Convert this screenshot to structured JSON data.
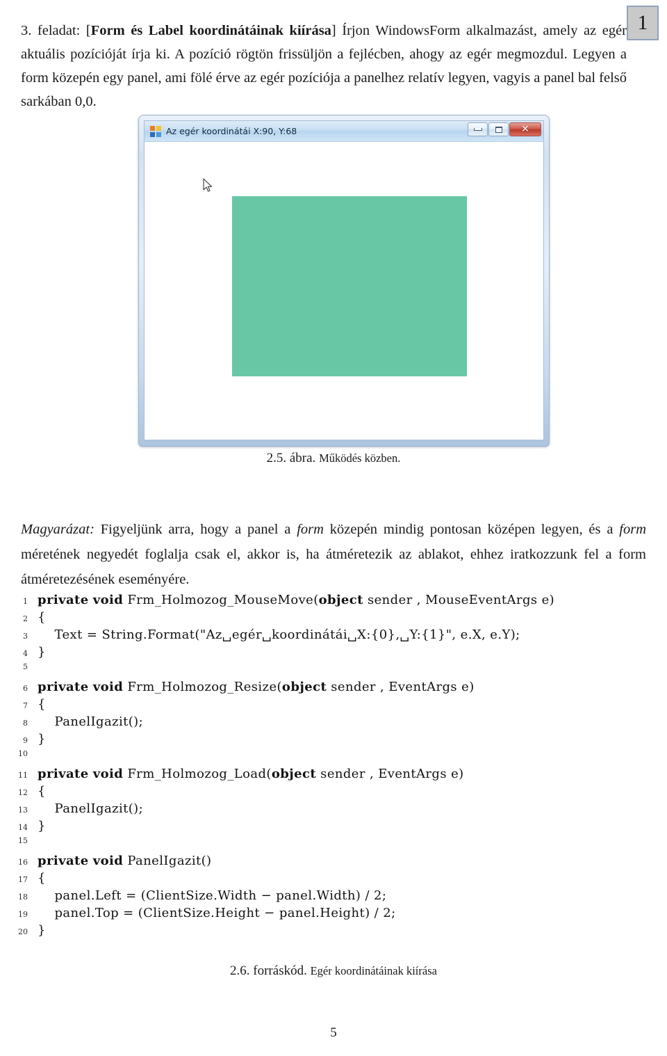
{
  "margin_marker": {
    "label": "1"
  },
  "intro": {
    "number": "3. feladat:",
    "bracket_open": "[",
    "bold_title": "Form és Label koordinátáinak kiírása",
    "bracket_close": "]",
    "body": "Írjon WindowsForm alkalmazást, amely az egér aktuális pozícióját írja ki. A pozíció rögtön frissüljön a fejlécben, ahogy az egér megmozdul. Legyen a form közepén egy panel, ami fölé érve az egér pozíciója a panelhez relatív legyen, vagyis a panel bal felső sarkában 0,0."
  },
  "screenshot": {
    "window_title": "Az egér koordinátái X:90, Y:68",
    "app_icon": "winforms-app-icon",
    "buttons": {
      "minimize": "minimize-icon",
      "maximize": "maximize-icon",
      "close": "✕"
    },
    "cursor": "arrow-cursor",
    "panel_color": "#68c8a6"
  },
  "figure_caption": {
    "label": "2.5. ábra.",
    "text": "Működés közben."
  },
  "explanation": {
    "lead": "Magyarázat:",
    "part1": " Figyeljünk arra, hogy a panel a ",
    "em1": "form",
    "part2": " közepén mindig pontosan középen legyen, és a ",
    "em2": "form",
    "part3": " méretének negyedét foglalja csak el, akkor is, ha átméretezik az ablakot, ehhez iratkozzunk fel a form átméretezésének eseményére."
  },
  "code": {
    "lines": [
      {
        "n": "1",
        "text": "private void Frm_Holmozog_MouseMove(object sender , MouseEventArgs e)"
      },
      {
        "n": "2",
        "text": "{"
      },
      {
        "n": "3",
        "text": "    Text = String.Format(\"Az␣egér␣koordinátái␣X:{0},␣Y:{1}\", e.X, e.Y);"
      },
      {
        "n": "4",
        "text": "}"
      },
      {
        "n": "5",
        "text": ""
      },
      {
        "n": "6",
        "text": "private void Frm_Holmozog_Resize(object sender , EventArgs e)"
      },
      {
        "n": "7",
        "text": "{"
      },
      {
        "n": "8",
        "text": "    PanelIgazit();"
      },
      {
        "n": "9",
        "text": "}"
      },
      {
        "n": "10",
        "text": ""
      },
      {
        "n": "11",
        "text": "private void Frm_Holmozog_Load(object sender , EventArgs e)"
      },
      {
        "n": "12",
        "text": "{"
      },
      {
        "n": "13",
        "text": "    PanelIgazit();"
      },
      {
        "n": "14",
        "text": "}"
      },
      {
        "n": "15",
        "text": ""
      },
      {
        "n": "16",
        "text": "private void PanelIgazit()"
      },
      {
        "n": "17",
        "text": "{"
      },
      {
        "n": "18",
        "text": "    panel.Left = (ClientSize.Width − panel.Width) / 2;"
      },
      {
        "n": "19",
        "text": "    panel.Top = (ClientSize.Height − panel.Height) / 2;"
      },
      {
        "n": "20",
        "text": "}"
      }
    ]
  },
  "source_caption": {
    "label": "2.6. forráskód.",
    "text": "Egér koordinátáinak kiírása"
  },
  "footer": {
    "page_number": "5"
  }
}
